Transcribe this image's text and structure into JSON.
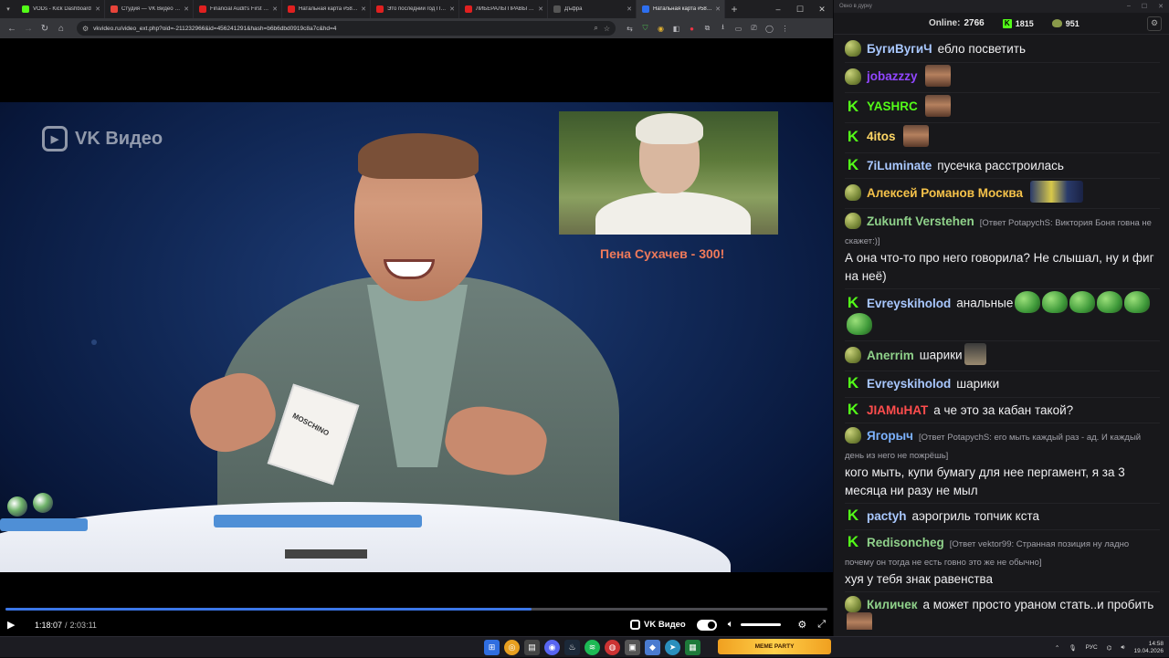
{
  "browser": {
    "tabs": [
      {
        "label": "VODs - Kick Dashboard",
        "color": "#53fc18",
        "active": false
      },
      {
        "label": "Студия — VK Видео Li…",
        "color": "#e8443a",
        "active": false
      },
      {
        "label": "Financial Audit's First F…",
        "color": "#e02020",
        "active": false
      },
      {
        "label": "Натальная карта #58 …",
        "color": "#e02020",
        "active": false
      },
      {
        "label": "Это последний год Пу…",
        "color": "#e02020",
        "active": false
      },
      {
        "label": "ЛИБЕРАЛЫ ПРАВЫ В…",
        "color": "#e02020",
        "active": false
      },
      {
        "label": "Дъфра",
        "color": "#555555",
        "active": false
      },
      {
        "label": "Натальная карта #58 …",
        "color": "#2d6ff0",
        "active": true
      }
    ],
    "url": "vkvideo.ru/video_ext.php?oid=-211232966&id=456241291&hash=b6b6dbd0919c8a7c&hd=4"
  },
  "video": {
    "watermark": "VK Видео",
    "caption": "Пена Сухачев - 300!",
    "card_text": "MOSCHINO",
    "time_current": "1:18:07",
    "time_separator": "/",
    "time_total": "2:03:11",
    "progress_fraction": 0.64,
    "brand": "VK Видео"
  },
  "chat": {
    "window_title": "Окно в дурку",
    "online_label": "Online:",
    "online_count": "2766",
    "kick_count": "1815",
    "frog_count": "951",
    "messages": [
      {
        "badge": "frog",
        "user": "БугиВугиЧ",
        "user_color": "#a9c8ff",
        "text": "ебло посветить",
        "emotes": []
      },
      {
        "badge": "frog",
        "user": "jobazzzy",
        "user_color": "#9146ff",
        "text": "",
        "emotes": [
          "face"
        ]
      },
      {
        "badge": "k",
        "user": "YASHRC",
        "user_color": "#53fc18",
        "text": "",
        "emotes": [
          "face"
        ]
      },
      {
        "badge": "k",
        "user": "4itos",
        "user_color": "#ffd866",
        "text": "",
        "emotes": [
          "face"
        ]
      },
      {
        "badge": "k",
        "user": "7iLuminate",
        "user_color": "#a9c8ff",
        "text": "пусечка расстроилась",
        "emotes": []
      },
      {
        "badge": "frog",
        "user": "Алексей Романов Москва",
        "user_color": "#f5c24a",
        "text": "",
        "emotes": [
          "wide"
        ]
      },
      {
        "badge": "frog",
        "user": "Zukunft Verstehen",
        "user_color": "#8fd18a",
        "reply": "[Ответ PotapychS: Виктория Боня говна не скажет:)]",
        "text": "А она что-то про него говорила? Не слышал, ну и фиг на неё)",
        "emotes": []
      },
      {
        "badge": "k",
        "user": "Evreyskiholod",
        "user_color": "#a9c8ff",
        "text": "анальные",
        "emotes": [
          "pepe",
          "pepe",
          "pepe",
          "pepe",
          "pepe",
          "pepe"
        ]
      },
      {
        "badge": "frog",
        "user": "Anerrim",
        "user_color": "#8fd18a",
        "text": "шарики",
        "emotes": [
          "small"
        ]
      },
      {
        "badge": "k",
        "user": "Evreyskiholod",
        "user_color": "#a9c8ff",
        "text": "шарики",
        "emotes": []
      },
      {
        "badge": "k",
        "user": "JIAMuHAT",
        "user_color": "#ff4d4d",
        "text": "а че это за кабан такой?",
        "emotes": []
      },
      {
        "badge": "frog",
        "user": "Ягорыч",
        "user_color": "#7db3ff",
        "reply": "[Ответ PotapychS: его мыть каждый раз - ад. И каждый день из него не пожрёшь]",
        "text": "кого мыть, купи бумагу для нее пергамент, я за 3 месяца ни разу не мыл",
        "emotes": []
      },
      {
        "badge": "k",
        "user": "pactyh",
        "user_color": "#a9c8ff",
        "text": "аэрогриль топчик кста",
        "emotes": []
      },
      {
        "badge": "k",
        "user": "Redisoncheg",
        "user_color": "#8fd18a",
        "reply": "[Ответ vektor99: Странная позиция ну ладно почему он тогда не есть говно это же не обычно]",
        "text": "хуя у тебя знак равенства",
        "emotes": []
      },
      {
        "badge": "frog",
        "user": "Киличек",
        "user_color": "#8fd18a",
        "text": "а может просто ураном стать..и пробить",
        "emotes": [
          "face"
        ]
      }
    ]
  },
  "taskbar": {
    "banner": "MEME PARTY",
    "lang": "РУС",
    "time": "14:58",
    "date": "19.04.2026"
  }
}
